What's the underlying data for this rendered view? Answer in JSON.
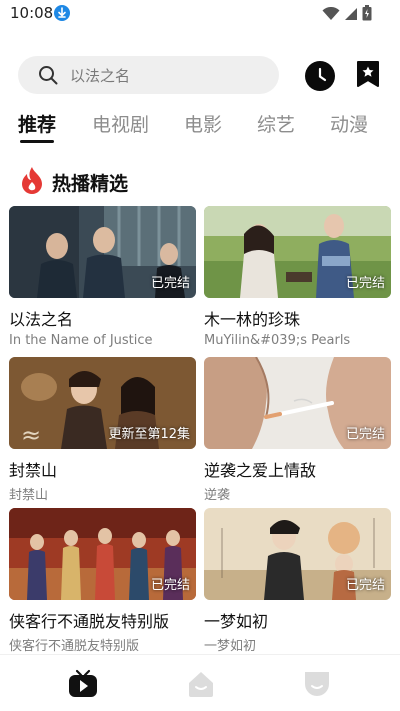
{
  "status_bar": {
    "time": "10:08",
    "icons": [
      "download-icon",
      "wifi-icon",
      "signal-icon",
      "battery-icon"
    ]
  },
  "search": {
    "placeholder": "以法之名"
  },
  "tabs": [
    {
      "label": "推荐",
      "active": true
    },
    {
      "label": "电视剧",
      "active": false
    },
    {
      "label": "电影",
      "active": false
    },
    {
      "label": "综艺",
      "active": false
    },
    {
      "label": "动漫",
      "active": false
    }
  ],
  "section": {
    "title": "热播精选",
    "icon": "fire-icon",
    "icon_color": "#e53935"
  },
  "cards": [
    {
      "title": "以法之名",
      "subtitle": "In the Name of Justice",
      "badge": "已完结"
    },
    {
      "title": "木一林的珍珠",
      "subtitle": "MuYilin&#039;s Pearls",
      "badge": "已完结"
    },
    {
      "title": "封禁山",
      "subtitle": "封禁山",
      "badge": "更新至第12集"
    },
    {
      "title": "逆袭之爱上情敌",
      "subtitle": "逆袭",
      "badge": "已完结"
    },
    {
      "title": "侠客行不通脱友特别版",
      "subtitle": "侠客行不通脱友特别版",
      "badge": "已完结"
    },
    {
      "title": "一梦如初",
      "subtitle": "一梦如初",
      "badge": "已完结"
    }
  ],
  "bottom_nav": [
    {
      "icon": "tv-play-icon",
      "active": true
    },
    {
      "icon": "home-icon",
      "active": false
    },
    {
      "icon": "profile-icon",
      "active": false
    }
  ],
  "colors": {
    "accent": "#111111",
    "search_bg": "#efefef",
    "tab_inactive": "#8d8d8d",
    "nav_inactive": "#dcdcdc"
  }
}
